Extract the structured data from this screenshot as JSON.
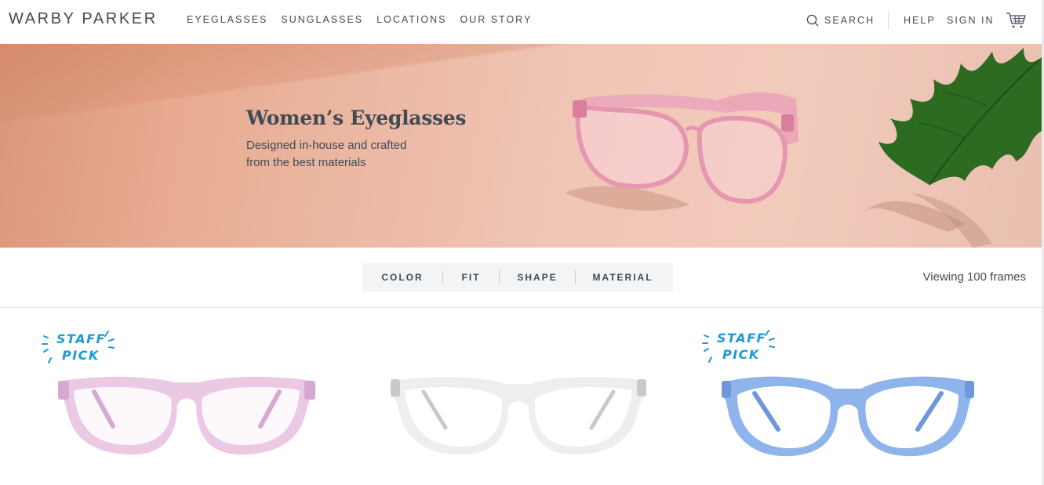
{
  "brand": "WARBY PARKER",
  "nav": [
    "EYEGLASSES",
    "SUNGLASSES",
    "LOCATIONS",
    "OUR STORY"
  ],
  "utility": {
    "search_label": "SEARCH",
    "help_label": "HELP",
    "signin_label": "SIGN IN"
  },
  "hero": {
    "title": "Women’s Eyeglasses",
    "subtitle_line1": "Designed in-house and crafted",
    "subtitle_line2": "from the best materials"
  },
  "filters": [
    "COLOR",
    "FIT",
    "SHAPE",
    "MATERIAL"
  ],
  "viewing": "Viewing 100 frames",
  "products": [
    {
      "staff_pick": true,
      "badge_line1": "STAFF",
      "badge_line2": "PICK",
      "frame_color": "#e9c3e2",
      "frame_edge": "#d7a9d0"
    },
    {
      "staff_pick": false,
      "frame_color": "#eeeeee",
      "frame_edge": "#c9c9c9"
    },
    {
      "staff_pick": true,
      "badge_line1": "STAFF",
      "badge_line2": "PICK",
      "frame_color": "#8fb4ec",
      "frame_edge": "#6f98dc"
    }
  ],
  "colors": {
    "text": "#414b56",
    "accent_blue": "#1b9ad6",
    "filter_bg": "#f3f4f5"
  },
  "icons": [
    "search-icon",
    "cart-icon"
  ]
}
